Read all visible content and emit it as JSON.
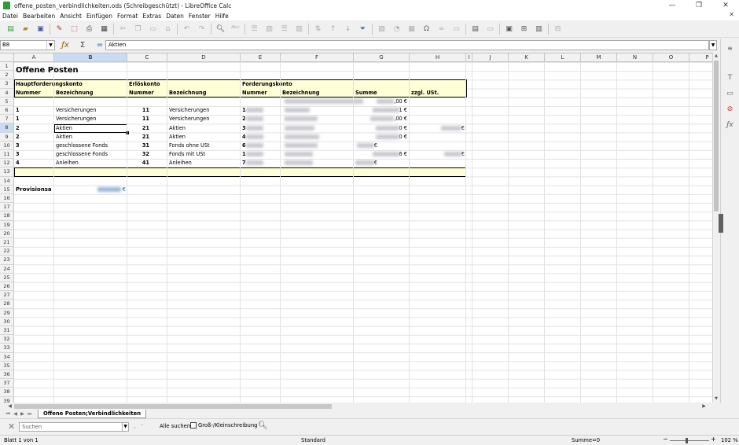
{
  "window": {
    "title": "offene_posten_verbindlichkeiten.ods (Schreibgeschützt) - LibreOffice Calc",
    "min": "—",
    "max": "❐",
    "close": "✕"
  },
  "menu": [
    "Datei",
    "Bearbeiten",
    "Ansicht",
    "Einfügen",
    "Format",
    "Extras",
    "Daten",
    "Fenster",
    "Hilfe"
  ],
  "formula": {
    "cell_ref": "B8",
    "content": "Aktien",
    "sum_icon": "Σ",
    "eq_icon": "="
  },
  "columns": [
    "A",
    "B",
    "C",
    "D",
    "E",
    "F",
    "G",
    "H",
    "I",
    "J",
    "K",
    "L",
    "M",
    "N",
    "O",
    "P"
  ],
  "selected_column": "B",
  "selected_row": 8,
  "rows_visible": 39,
  "sheet": {
    "title": "Offene Posten",
    "groups": {
      "a": "Hauptforderungskonto",
      "c": "Erlöskonto",
      "e": "Forderungskonto"
    },
    "headers": {
      "a": "Nummer",
      "b": "Bezeichnung",
      "c": "Nummer",
      "d": "Bezeichnung",
      "e": "Nummer",
      "f": "Bezeichnung",
      "g": "Summe",
      "h": "zzgl. USt."
    },
    "r5": {
      "g": ",00 €"
    },
    "r6": {
      "a": "1",
      "b": "Versicherungen",
      "c": "11",
      "d": "Versicherungen",
      "e": "1",
      "g": "1 €"
    },
    "r7": {
      "a": "1",
      "b": "Versicherungen",
      "c": "11",
      "d": "Versicherungen",
      "e": "2",
      "g": ",00 €"
    },
    "r8": {
      "a": "2",
      "b": "Aktien",
      "c": "21",
      "d": "Aktien",
      "e": "3",
      "g": "0 €",
      "h": "€"
    },
    "r9": {
      "a": "2",
      "b": "Aktien",
      "c": "21",
      "d": "Aktien",
      "e": "4",
      "g": "0 €"
    },
    "r10": {
      "a": "3",
      "b": "geschlossene Fonds",
      "c": "31",
      "d": "Fonds ohne USt",
      "e": "6",
      "g": "€"
    },
    "r11": {
      "a": "3",
      "b": "geschlossene Fonds",
      "c": "32",
      "d": "Fonds mit USt",
      "e": "1",
      "g": "6 €",
      "h": "€"
    },
    "r12": {
      "a": "4",
      "b": "Anleihen",
      "c": "41",
      "d": "Anleihen",
      "e": "7",
      "g": "€"
    },
    "r15": {
      "a": "Provisionsa",
      "b": "€"
    }
  },
  "tabs": {
    "active": "Offene Posten;Verbindlichkeiten"
  },
  "find": {
    "placeholder": "Suchen",
    "find_all": "Alle suchen",
    "match_case": "Groß-/Kleinschreibung"
  },
  "status": {
    "sheet": "Blatt 1 von 1",
    "style": "Standard",
    "sum": "Summe=0",
    "zoom": "102 %"
  }
}
